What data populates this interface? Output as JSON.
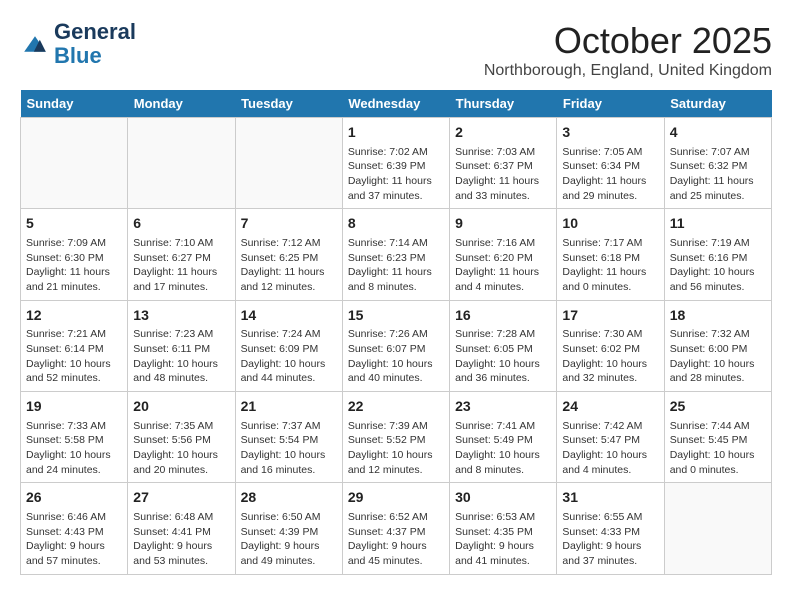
{
  "header": {
    "logo_line1": "General",
    "logo_line2": "Blue",
    "month": "October 2025",
    "location": "Northborough, England, United Kingdom"
  },
  "weekdays": [
    "Sunday",
    "Monday",
    "Tuesday",
    "Wednesday",
    "Thursday",
    "Friday",
    "Saturday"
  ],
  "weeks": [
    [
      {
        "day": "",
        "info": ""
      },
      {
        "day": "",
        "info": ""
      },
      {
        "day": "",
        "info": ""
      },
      {
        "day": "1",
        "info": "Sunrise: 7:02 AM\nSunset: 6:39 PM\nDaylight: 11 hours\nand 37 minutes."
      },
      {
        "day": "2",
        "info": "Sunrise: 7:03 AM\nSunset: 6:37 PM\nDaylight: 11 hours\nand 33 minutes."
      },
      {
        "day": "3",
        "info": "Sunrise: 7:05 AM\nSunset: 6:34 PM\nDaylight: 11 hours\nand 29 minutes."
      },
      {
        "day": "4",
        "info": "Sunrise: 7:07 AM\nSunset: 6:32 PM\nDaylight: 11 hours\nand 25 minutes."
      }
    ],
    [
      {
        "day": "5",
        "info": "Sunrise: 7:09 AM\nSunset: 6:30 PM\nDaylight: 11 hours\nand 21 minutes."
      },
      {
        "day": "6",
        "info": "Sunrise: 7:10 AM\nSunset: 6:27 PM\nDaylight: 11 hours\nand 17 minutes."
      },
      {
        "day": "7",
        "info": "Sunrise: 7:12 AM\nSunset: 6:25 PM\nDaylight: 11 hours\nand 12 minutes."
      },
      {
        "day": "8",
        "info": "Sunrise: 7:14 AM\nSunset: 6:23 PM\nDaylight: 11 hours\nand 8 minutes."
      },
      {
        "day": "9",
        "info": "Sunrise: 7:16 AM\nSunset: 6:20 PM\nDaylight: 11 hours\nand 4 minutes."
      },
      {
        "day": "10",
        "info": "Sunrise: 7:17 AM\nSunset: 6:18 PM\nDaylight: 11 hours\nand 0 minutes."
      },
      {
        "day": "11",
        "info": "Sunrise: 7:19 AM\nSunset: 6:16 PM\nDaylight: 10 hours\nand 56 minutes."
      }
    ],
    [
      {
        "day": "12",
        "info": "Sunrise: 7:21 AM\nSunset: 6:14 PM\nDaylight: 10 hours\nand 52 minutes."
      },
      {
        "day": "13",
        "info": "Sunrise: 7:23 AM\nSunset: 6:11 PM\nDaylight: 10 hours\nand 48 minutes."
      },
      {
        "day": "14",
        "info": "Sunrise: 7:24 AM\nSunset: 6:09 PM\nDaylight: 10 hours\nand 44 minutes."
      },
      {
        "day": "15",
        "info": "Sunrise: 7:26 AM\nSunset: 6:07 PM\nDaylight: 10 hours\nand 40 minutes."
      },
      {
        "day": "16",
        "info": "Sunrise: 7:28 AM\nSunset: 6:05 PM\nDaylight: 10 hours\nand 36 minutes."
      },
      {
        "day": "17",
        "info": "Sunrise: 7:30 AM\nSunset: 6:02 PM\nDaylight: 10 hours\nand 32 minutes."
      },
      {
        "day": "18",
        "info": "Sunrise: 7:32 AM\nSunset: 6:00 PM\nDaylight: 10 hours\nand 28 minutes."
      }
    ],
    [
      {
        "day": "19",
        "info": "Sunrise: 7:33 AM\nSunset: 5:58 PM\nDaylight: 10 hours\nand 24 minutes."
      },
      {
        "day": "20",
        "info": "Sunrise: 7:35 AM\nSunset: 5:56 PM\nDaylight: 10 hours\nand 20 minutes."
      },
      {
        "day": "21",
        "info": "Sunrise: 7:37 AM\nSunset: 5:54 PM\nDaylight: 10 hours\nand 16 minutes."
      },
      {
        "day": "22",
        "info": "Sunrise: 7:39 AM\nSunset: 5:52 PM\nDaylight: 10 hours\nand 12 minutes."
      },
      {
        "day": "23",
        "info": "Sunrise: 7:41 AM\nSunset: 5:49 PM\nDaylight: 10 hours\nand 8 minutes."
      },
      {
        "day": "24",
        "info": "Sunrise: 7:42 AM\nSunset: 5:47 PM\nDaylight: 10 hours\nand 4 minutes."
      },
      {
        "day": "25",
        "info": "Sunrise: 7:44 AM\nSunset: 5:45 PM\nDaylight: 10 hours\nand 0 minutes."
      }
    ],
    [
      {
        "day": "26",
        "info": "Sunrise: 6:46 AM\nSunset: 4:43 PM\nDaylight: 9 hours\nand 57 minutes."
      },
      {
        "day": "27",
        "info": "Sunrise: 6:48 AM\nSunset: 4:41 PM\nDaylight: 9 hours\nand 53 minutes."
      },
      {
        "day": "28",
        "info": "Sunrise: 6:50 AM\nSunset: 4:39 PM\nDaylight: 9 hours\nand 49 minutes."
      },
      {
        "day": "29",
        "info": "Sunrise: 6:52 AM\nSunset: 4:37 PM\nDaylight: 9 hours\nand 45 minutes."
      },
      {
        "day": "30",
        "info": "Sunrise: 6:53 AM\nSunset: 4:35 PM\nDaylight: 9 hours\nand 41 minutes."
      },
      {
        "day": "31",
        "info": "Sunrise: 6:55 AM\nSunset: 4:33 PM\nDaylight: 9 hours\nand 37 minutes."
      },
      {
        "day": "",
        "info": ""
      }
    ]
  ]
}
